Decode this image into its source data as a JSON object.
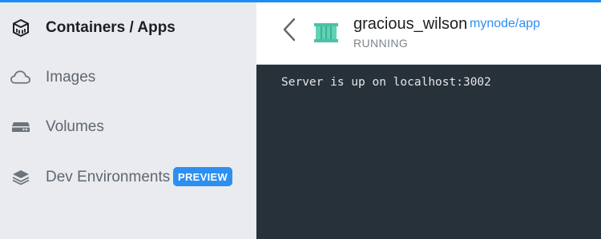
{
  "sidebar": {
    "items": [
      {
        "label": "Containers / Apps",
        "icon": "container-cube-icon",
        "active": true
      },
      {
        "label": "Images",
        "icon": "cloud-icon",
        "active": false
      },
      {
        "label": "Volumes",
        "icon": "volume-drive-icon",
        "active": false
      },
      {
        "label": "Dev Environments",
        "icon": "dev-environments-icon",
        "active": false,
        "badge": "PREVIEW"
      }
    ]
  },
  "header": {
    "container_name": "gracious_wilson",
    "image_link": "mynode/app",
    "status": "RUNNING",
    "icon": "container-icon"
  },
  "logs": {
    "lines": [
      "Server is up on localhost:3002"
    ]
  },
  "colors": {
    "accent": "#2d8ff0",
    "sidebar_bg": "#e9ebee",
    "terminal_bg": "#27313a",
    "container_icon": "#5fd3b5"
  }
}
